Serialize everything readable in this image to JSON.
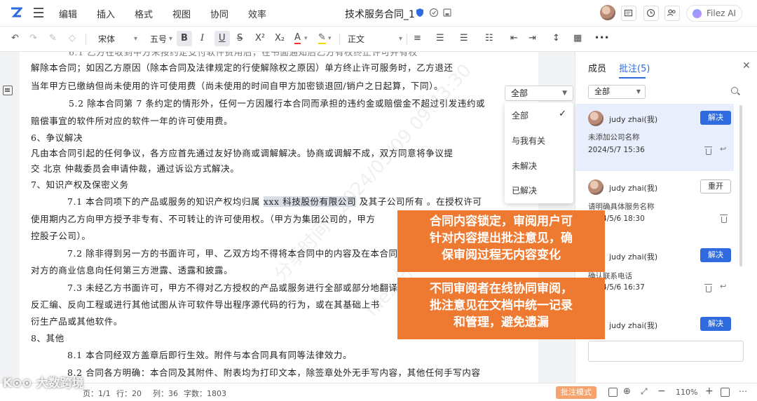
{
  "menubar": {
    "menus": [
      "编辑",
      "插入",
      "格式",
      "视图",
      "协同",
      "效率"
    ],
    "doc_title": "技术服务合同_1",
    "ai_label": "Filez AI"
  },
  "toolbar": {
    "font": "宋体",
    "size": "五号",
    "bold": "B",
    "italic": "I",
    "underline": "U",
    "strike": "S",
    "superscript": "X²",
    "subscript": "X₂",
    "font_color": "A",
    "style": "正文"
  },
  "document": {
    "lines": [
      "6.1 乙方在收到甲方未按约定支付软件费用后，在书面通知后乙方有权终止许可并有权",
      "解除本合同；如因乙方原因（除本合同及法律规定的行使解除权之原因）单方终止许可服务时，乙方退还",
      "当年甲方已缴纳但尚未使用的许可使用费（尚未使用的时间自甲方加密锁退回/销户之日起算，下同）。",
      "5.2 除本合同第 7 条约定的情形外，任何一方因履行本合同而承担的违约金或赔偿金不超过引发违约或",
      "赔偿事宜的软件所对应的软件一年的许可使用费。",
      "6、争议解决",
      "凡由本合同引起的任何争议，各方应首先通过友好协商或调解解决。协商或调解不成，双方同意将争议提",
      "交   北京  仲裁委员会申请仲裁，通过诉讼方式解决。",
      "7、知识产权及保密义务",
      "7.1  本合同项下的产品或服务的知识产权均归属",
      "xxx 科技股份有限公司",
      "及其子公司所有  。在授权许可",
      "使用期内乙方向甲方授予非专有、不可转让的许可使用权。（甲方为集团公司的，甲方",
      "控股子公司）。",
      "7.2  除非得到另一方的书面许可，甲、乙双方均不得将本合同中的内容及在本合同",
      "对方的商业信息向任何第三方泄露、透露和披露。",
      "7.3  未经乙方书面许可，甲方不得对乙方授权的产品或服务进行全部或部分地翻译",
      "反汇编、反向工程或进行其他试图从许可软件导出程序源代码的行为，或在其基础上书",
      "衍生产品或其他软件。",
      "8、其他",
      "8.1 本合同经双方盖章后即行生效。附件与本合同具有同等法律效力。",
      "8.2 合同各方明确：本合同及其附件、附表均为打印文本，除签章处外无手写内容，其他任何手写内容"
    ]
  },
  "filter": {
    "selected": "全部",
    "options": [
      "全部",
      "与我有关",
      "未解决",
      "已解决"
    ]
  },
  "panel": {
    "tab_members": "成员",
    "tab_comments": "批注(5)",
    "filter_value": "全部",
    "cards": [
      {
        "name": "judy zhai(我)",
        "button": "解决",
        "text": "未添加公司名称",
        "date": "2024/5/7 15:36"
      },
      {
        "name": "judy zhai(我)",
        "button": "重开",
        "text": "请明确具体服务名称",
        "date": "2024/5/6 18:30"
      },
      {
        "name": "judy zhai(我)",
        "button": "解决",
        "text": "确认联系电话",
        "date": "2024/5/6 16:37"
      },
      {
        "name": "judy zhai(我)",
        "button": "解决",
        "text": "",
        "date": ""
      }
    ]
  },
  "overlays": {
    "box1": [
      "合同内容锁定，审阅用户可",
      "针对内容提出批注意见，确",
      "保审阅过程无内容变化"
    ],
    "box2": [
      "不同审阅者在线协同审阅，",
      "批注意见在文档中统一记录",
      "和管理，避免遗漏"
    ]
  },
  "statusbar": {
    "page": "页：1/1",
    "row": "行：20",
    "col": "列：36",
    "chars": "字数：1803",
    "mode_button": "批注模式",
    "zoom": "110%",
    "brand": "K⊙⊙ 大数跨境"
  },
  "watermarks": [
    "分享时间：2024/05/09 09:43:30",
    "filez 分享用户"
  ]
}
